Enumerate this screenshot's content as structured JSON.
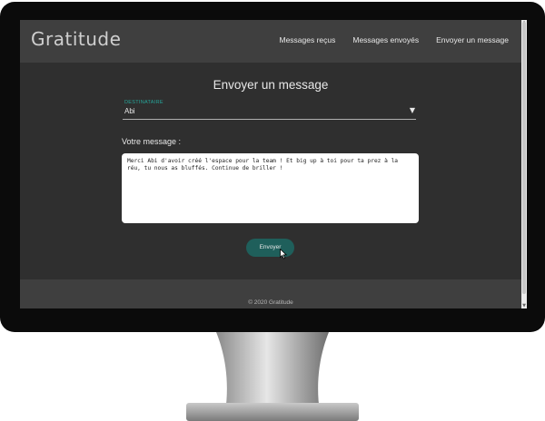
{
  "app": {
    "brand": "Gratitude"
  },
  "nav": {
    "received": "Messages reçus",
    "sent": "Messages envoyés",
    "send": "Envoyer un message"
  },
  "form": {
    "title": "Envoyer un message",
    "recipient_label": "DESTINATAIRE",
    "recipient_value": "Abi",
    "message_label": "Votre message :",
    "message_value": "Merci Abi d'avoir créé l'espace pour la team ! Et big up à toi pour ta prez à la réu, tu nous as bluffés. Continue de briller !",
    "submit_label": "Envoyer"
  },
  "footer": {
    "copyright": "© 2020 Gratitude"
  },
  "colors": {
    "accent": "#26a69a",
    "button": "#1f5f5b",
    "navbar": "#3f3f3f",
    "background": "#2f2f2f"
  },
  "icons": {
    "dropdown": "triangle-down-icon",
    "cursor": "mouse-pointer-icon"
  }
}
